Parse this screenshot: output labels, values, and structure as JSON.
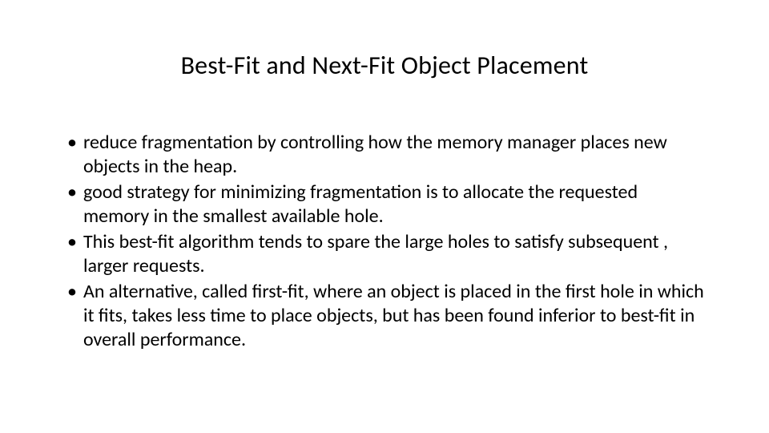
{
  "slide": {
    "title": "Best-Fit and Next-Fit Object Placement",
    "bullets": [
      "reduce fragmentation by controlling how the memory manager places new objects in the heap.",
      "good strategy for minimizing fragmentation is to allocate the requested memory in the smallest available hole.",
      "This best-fit algorithm tends to spare the large holes to satisfy subsequent , larger requests.",
      "An alternative, called first-fit, where an object is placed in the first hole in which it fits, takes less time to place objects, but has been found inferior to best-fit in overall performance."
    ]
  }
}
